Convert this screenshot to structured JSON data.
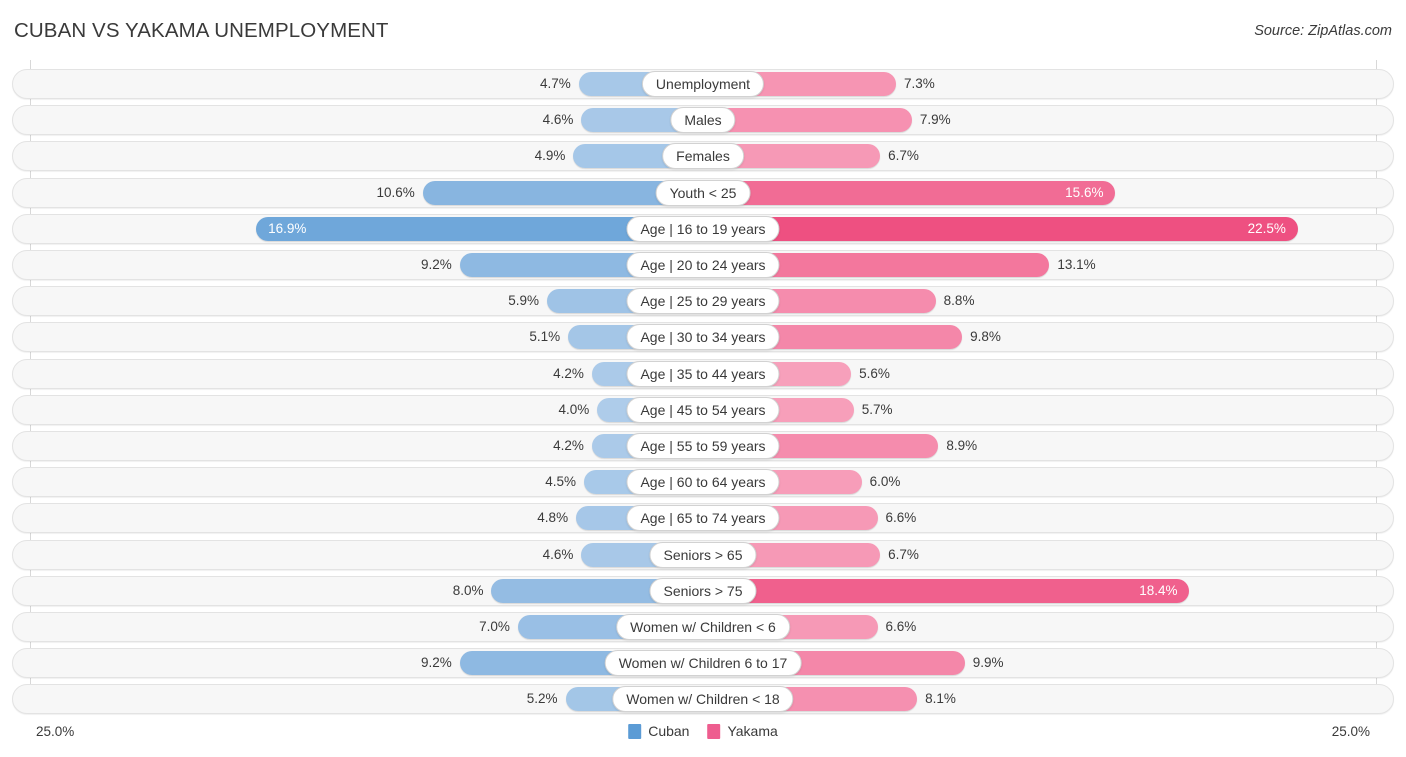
{
  "header": {
    "title": "CUBAN VS YAKAMA UNEMPLOYMENT",
    "source": "Source: ZipAtlas.com"
  },
  "legend": {
    "left": {
      "label": "Cuban",
      "color": "#5B9BD5"
    },
    "right": {
      "label": "Yakama",
      "color": "#EE5D8F"
    }
  },
  "axis": {
    "left_max": "25.0%",
    "right_max": "25.0%"
  },
  "chart_data": {
    "type": "bar",
    "subtype": "diverging-bidirectional",
    "title": "CUBAN VS YAKAMA UNEMPLOYMENT",
    "xlabel": "",
    "ylabel": "",
    "xlim": [
      25.0,
      25.0
    ],
    "grid": false,
    "legend_position": "bottom-center",
    "categories": [
      "Unemployment",
      "Males",
      "Females",
      "Youth < 25",
      "Age | 16 to 19 years",
      "Age | 20 to 24 years",
      "Age | 25 to 29 years",
      "Age | 30 to 34 years",
      "Age | 35 to 44 years",
      "Age | 45 to 54 years",
      "Age | 55 to 59 years",
      "Age | 60 to 64 years",
      "Age | 65 to 74 years",
      "Seniors > 65",
      "Seniors > 75",
      "Women w/ Children < 6",
      "Women w/ Children 6 to 17",
      "Women w/ Children < 18"
    ],
    "series": [
      {
        "name": "Cuban",
        "color": "#5B9BD5",
        "values": [
          4.7,
          4.6,
          4.9,
          10.6,
          16.9,
          9.2,
          5.9,
          5.1,
          4.2,
          4.0,
          4.2,
          4.5,
          4.8,
          4.6,
          8.0,
          7.0,
          9.2,
          5.2
        ],
        "labels": [
          "4.7%",
          "4.6%",
          "4.9%",
          "10.6%",
          "16.9%",
          "9.2%",
          "5.9%",
          "5.1%",
          "4.2%",
          "4.0%",
          "4.2%",
          "4.5%",
          "4.8%",
          "4.6%",
          "8.0%",
          "7.0%",
          "9.2%",
          "5.2%"
        ]
      },
      {
        "name": "Yakama",
        "color": "#EE5D8F",
        "values": [
          7.3,
          7.9,
          6.7,
          15.6,
          22.5,
          13.1,
          8.8,
          9.8,
          5.6,
          5.7,
          8.9,
          6.0,
          6.6,
          6.7,
          18.4,
          6.6,
          9.9,
          8.1
        ],
        "labels": [
          "7.3%",
          "7.9%",
          "6.7%",
          "15.6%",
          "22.5%",
          "13.1%",
          "8.8%",
          "9.8%",
          "5.6%",
          "5.7%",
          "8.9%",
          "6.0%",
          "6.6%",
          "6.7%",
          "18.4%",
          "6.6%",
          "9.9%",
          "8.1%"
        ]
      }
    ]
  }
}
